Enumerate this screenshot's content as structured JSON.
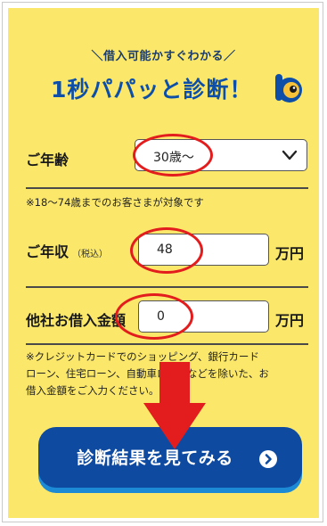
{
  "header": {
    "tagline": "＼借入可能かすぐわかる／",
    "headline": "1秒パパッと診断！"
  },
  "age": {
    "label": "ご年齢",
    "selected": "30歳〜",
    "note": "※18〜74歳までのお客さまが対象です"
  },
  "income": {
    "label": "ご年収",
    "sub": "（税込）",
    "value": "48",
    "unit": "万円"
  },
  "borrow": {
    "label": "他社お借入金額",
    "value": "0",
    "unit": "万円",
    "note_lines": [
      "※クレジットカードでのショッピング、銀行カード",
      "ローン、住宅ローン、自動車ローンなどを除いた、お",
      "借入金額をご入力ください。"
    ]
  },
  "cta": {
    "label": "診断結果を見てみる"
  },
  "colors": {
    "background": "#fbe86a",
    "brand_blue": "#0e4aa0",
    "highlight_red": "#e31d1d"
  },
  "icons": [
    "mascot-icon",
    "chevron-down-icon",
    "arrow-circle-right-icon",
    "down-arrow-annotation"
  ]
}
